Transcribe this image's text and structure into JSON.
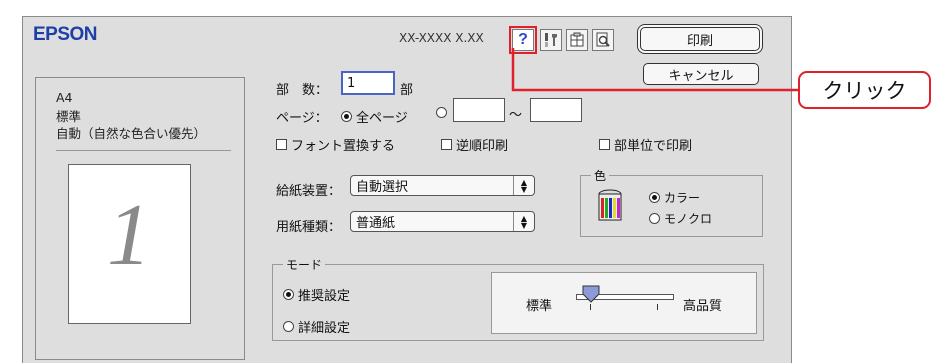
{
  "header": {
    "brand": "EPSON",
    "model": "XX-XXXX X.XX"
  },
  "toolbar": {
    "help_icon_glyph": "?",
    "print_button": "印刷",
    "cancel_button": "キャンセル"
  },
  "callout": {
    "text": "クリック",
    "color": "#e0202a"
  },
  "preview": {
    "paper_size": "A4",
    "quality": "標準",
    "color_mode": "自動（自然な色合い優先）",
    "page_number": "1"
  },
  "copies": {
    "label": "部　数：",
    "value": "1",
    "unit": "部"
  },
  "pages": {
    "label": "ページ：",
    "all_label": "全ページ",
    "range_from": "",
    "range_separator": "〜",
    "range_to": "",
    "selected": "all"
  },
  "options": {
    "font_replace": "フォント置換する",
    "reverse_print": "逆順印刷",
    "collate": "部単位で印刷"
  },
  "paper_source": {
    "label": "給紙装置：",
    "value": "自動選択"
  },
  "paper_type": {
    "label": "用紙種類：",
    "value": "普通紙"
  },
  "color_group": {
    "title": "色",
    "color_option": "カラー",
    "mono_option": "モノクロ",
    "selected": "color"
  },
  "mode_group": {
    "title": "モード",
    "recommended": "推奨設定",
    "detailed": "詳細設定",
    "selected": "recommended"
  },
  "quality_slider": {
    "low_label": "標準",
    "high_label": "高品質",
    "level": 0
  }
}
